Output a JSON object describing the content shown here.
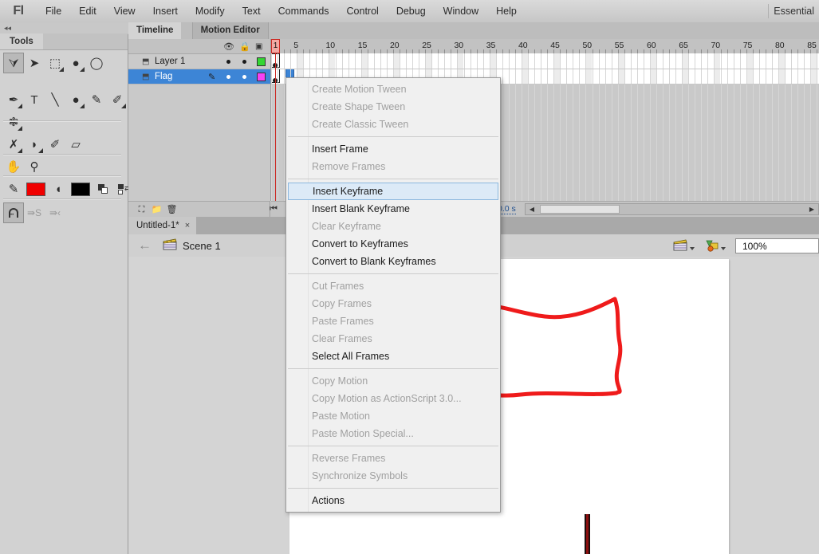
{
  "app": {
    "logo": "Fl",
    "workspace": "Essential"
  },
  "menubar": {
    "items": [
      "File",
      "Edit",
      "View",
      "Insert",
      "Modify",
      "Text",
      "Commands",
      "Control",
      "Debug",
      "Window",
      "Help"
    ]
  },
  "tools": {
    "panel_title": "Tools",
    "collapse_glyph": "◂◂",
    "rows": [
      [
        {
          "name": "selection-tool",
          "glyph": "⮛",
          "selected": true,
          "menu": false
        },
        {
          "name": "subselection-tool",
          "glyph": "➤",
          "selected": false,
          "menu": false
        },
        {
          "name": "free-transform-tool",
          "glyph": "⬚",
          "selected": false,
          "menu": true
        },
        {
          "name": "lasso-tool",
          "glyph": "●",
          "selected": false,
          "menu": true
        },
        {
          "name": "lasso-alt-tool",
          "glyph": "◯",
          "selected": false,
          "menu": false
        }
      ],
      [
        {
          "name": "pen-tool",
          "glyph": "✒",
          "selected": false,
          "menu": true
        },
        {
          "name": "text-tool",
          "glyph": "T",
          "selected": false,
          "menu": false
        },
        {
          "name": "line-tool",
          "glyph": "╲",
          "selected": false,
          "menu": false
        },
        {
          "name": "oval-tool",
          "glyph": "●",
          "selected": false,
          "menu": true
        },
        {
          "name": "pencil-tool",
          "glyph": "✎",
          "selected": false,
          "menu": false
        },
        {
          "name": "brush-tool",
          "glyph": "✐",
          "selected": false,
          "menu": true
        }
      ],
      [
        {
          "name": "deco-tool",
          "glyph": "❃",
          "selected": false,
          "menu": true
        }
      ],
      [
        {
          "name": "bone-tool",
          "glyph": "✗",
          "selected": false,
          "menu": true
        },
        {
          "name": "paint-bucket-tool",
          "glyph": "◗",
          "selected": false,
          "menu": true
        },
        {
          "name": "eyedropper-tool",
          "glyph": "✐",
          "selected": false,
          "menu": false
        },
        {
          "name": "eraser-tool",
          "glyph": "▱",
          "selected": false,
          "menu": false
        }
      ],
      [
        {
          "name": "hand-tool",
          "glyph": "✋",
          "selected": false,
          "menu": false
        },
        {
          "name": "zoom-tool",
          "glyph": "⚲",
          "selected": false,
          "menu": false
        }
      ]
    ],
    "colors": {
      "stroke_swatch": "#f00000",
      "fill_swatch": "#000000",
      "stroke_icon": "✐",
      "fill_icon": "◗",
      "bw_icon": "bw-colors-icon",
      "swap_icon": "swap-colors-icon"
    },
    "options": [
      {
        "name": "snap-to-objects-option",
        "glyph": "⛔",
        "selected": true
      },
      {
        "name": "smooth-option",
        "glyph": "∿",
        "selected": false
      },
      {
        "name": "straighten-option",
        "glyph": "‹",
        "selected": false
      }
    ]
  },
  "timeline": {
    "tabs": [
      {
        "label": "Timeline",
        "active": true
      },
      {
        "label": "Motion Editor",
        "active": false
      }
    ],
    "header_icons": [
      {
        "name": "eye-icon",
        "glyph": "◉"
      },
      {
        "name": "lock-icon",
        "glyph": "◯"
      },
      {
        "name": "outline-icon",
        "glyph": "□"
      }
    ],
    "layers": [
      {
        "name": "Layer 1",
        "color": "#33d633",
        "selected": false,
        "locked": false,
        "editing": false
      },
      {
        "name": "Flag",
        "color": "#f542f5",
        "selected": true,
        "locked": false,
        "editing": true
      }
    ],
    "ruler_ticks": [
      1,
      5,
      10,
      15,
      20,
      25,
      30,
      35,
      40,
      45,
      50,
      55,
      60,
      65,
      70,
      75,
      80,
      85
    ],
    "playhead_frame": "1",
    "footer_buttons": [
      {
        "name": "new-layer-button",
        "glyph": "◳"
      },
      {
        "name": "new-folder-button",
        "glyph": "▱"
      },
      {
        "name": "delete-layer-button",
        "glyph": "⌧"
      }
    ],
    "status": {
      "time": "0.0 s",
      "scroll_left_arrow": "◀",
      "scroll_right_arrow": "▶",
      "end_marker": "⏮"
    }
  },
  "document": {
    "tab_label": "Untitled-1*",
    "tab_close": "×"
  },
  "scene_bar": {
    "back_arrow": "←",
    "scene_name": "Scene 1",
    "scene_icon": "clapperboard-icon",
    "symbol_icon": "edit-symbols-icon",
    "zoom_value": "100%"
  },
  "context_menu": {
    "groups": [
      [
        {
          "label": "Create Motion Tween",
          "enabled": false,
          "highlighted": false
        },
        {
          "label": "Create Shape Tween",
          "enabled": false,
          "highlighted": false
        },
        {
          "label": "Create Classic Tween",
          "enabled": false,
          "highlighted": false
        }
      ],
      [
        {
          "label": "Insert Frame",
          "enabled": true,
          "highlighted": false
        },
        {
          "label": "Remove Frames",
          "enabled": false,
          "highlighted": false
        }
      ],
      [
        {
          "label": "Insert Keyframe",
          "enabled": true,
          "highlighted": true
        },
        {
          "label": "Insert Blank Keyframe",
          "enabled": true,
          "highlighted": false
        },
        {
          "label": "Clear Keyframe",
          "enabled": false,
          "highlighted": false
        },
        {
          "label": "Convert to Keyframes",
          "enabled": true,
          "highlighted": false
        },
        {
          "label": "Convert to Blank Keyframes",
          "enabled": true,
          "highlighted": false
        }
      ],
      [
        {
          "label": "Cut Frames",
          "enabled": false,
          "highlighted": false
        },
        {
          "label": "Copy Frames",
          "enabled": false,
          "highlighted": false
        },
        {
          "label": "Paste Frames",
          "enabled": false,
          "highlighted": false
        },
        {
          "label": "Clear Frames",
          "enabled": false,
          "highlighted": false
        },
        {
          "label": "Select All Frames",
          "enabled": true,
          "highlighted": false
        }
      ],
      [
        {
          "label": "Copy Motion",
          "enabled": false,
          "highlighted": false
        },
        {
          "label": "Copy Motion as ActionScript 3.0...",
          "enabled": false,
          "highlighted": false
        },
        {
          "label": "Paste Motion",
          "enabled": false,
          "highlighted": false
        },
        {
          "label": "Paste Motion Special...",
          "enabled": false,
          "highlighted": false
        }
      ],
      [
        {
          "label": "Reverse Frames",
          "enabled": false,
          "highlighted": false
        },
        {
          "label": "Synchronize Symbols",
          "enabled": false,
          "highlighted": false
        }
      ],
      [
        {
          "label": "Actions",
          "enabled": true,
          "highlighted": false
        }
      ]
    ]
  },
  "stage": {
    "artwork_name": "red-flag-drawing",
    "flag_stroke_color": "#ef1b1b",
    "pole_color": "#1a0d0d",
    "pole_inner_color": "#8c0f0f"
  }
}
